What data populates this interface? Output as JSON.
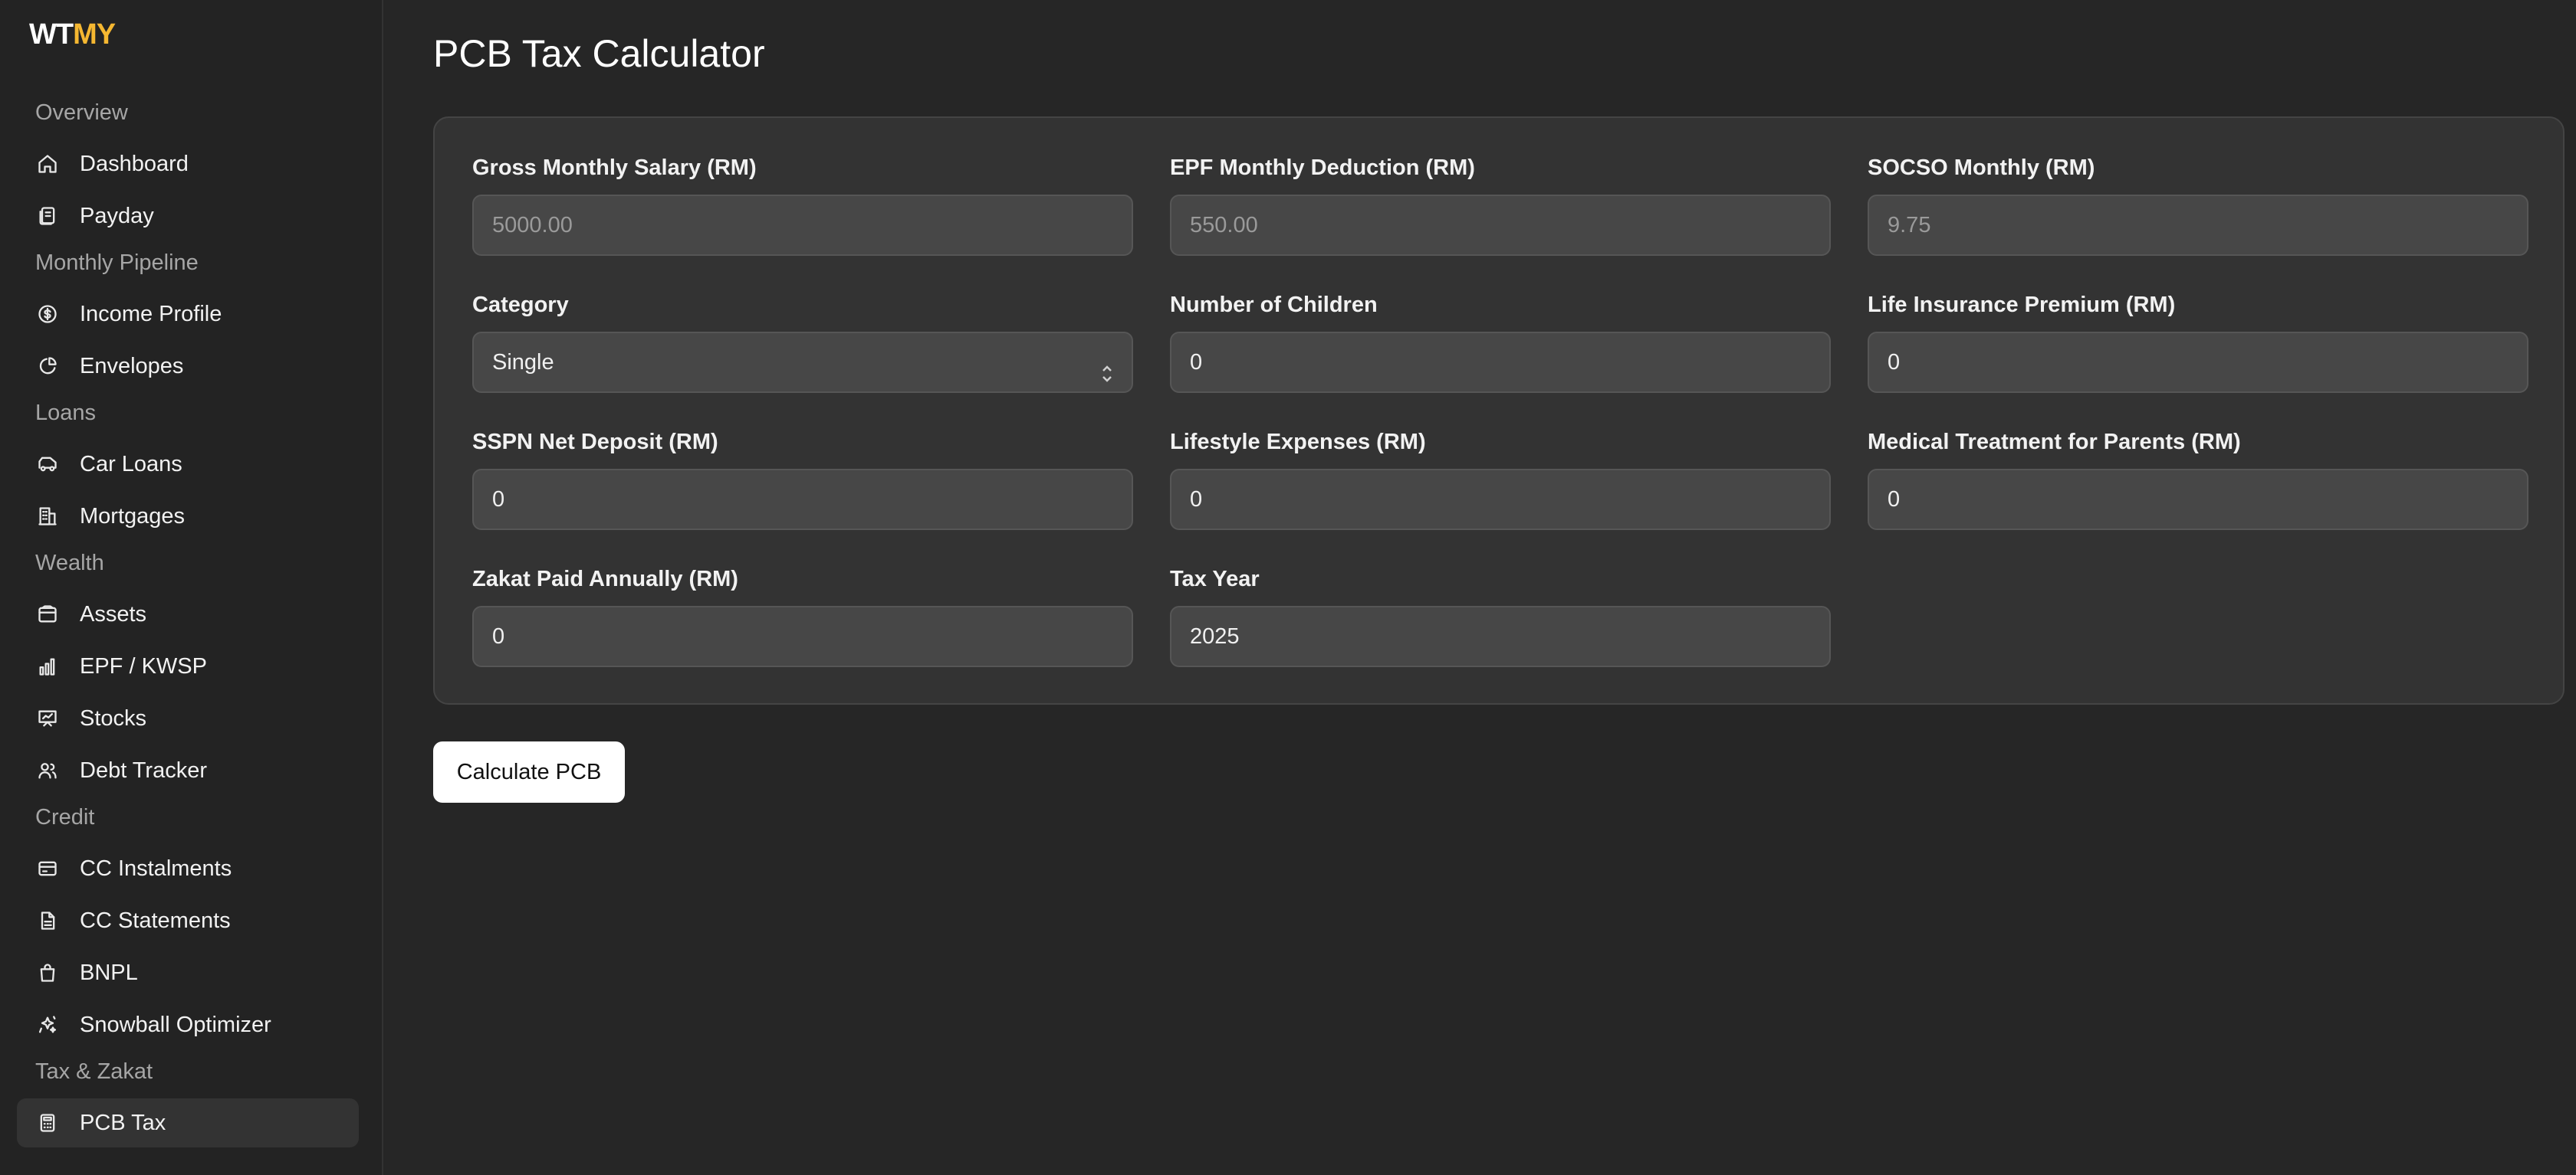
{
  "logo": {
    "part1": "WT",
    "part2": "MY"
  },
  "sidebar": {
    "groups": [
      {
        "label": "Overview"
      },
      {
        "label": "Monthly Pipeline"
      },
      {
        "label": "Loans"
      },
      {
        "label": "Wealth"
      },
      {
        "label": "Credit"
      },
      {
        "label": "Tax & Zakat"
      }
    ],
    "items": [
      {
        "label": "Dashboard",
        "icon": "home-icon"
      },
      {
        "label": "Payday",
        "icon": "receipt-icon"
      },
      {
        "label": "Income Profile",
        "icon": "dollar-circle-icon"
      },
      {
        "label": "Envelopes",
        "icon": "pie-chart-icon"
      },
      {
        "label": "Car Loans",
        "icon": "car-icon"
      },
      {
        "label": "Mortgages",
        "icon": "building-icon"
      },
      {
        "label": "Assets",
        "icon": "wallet-icon"
      },
      {
        "label": "EPF / KWSP",
        "icon": "bar-chart-icon"
      },
      {
        "label": "Stocks",
        "icon": "presentation-chart-icon"
      },
      {
        "label": "Debt Tracker",
        "icon": "users-icon"
      },
      {
        "label": "CC Instalments",
        "icon": "credit-card-icon"
      },
      {
        "label": "CC Statements",
        "icon": "file-text-icon"
      },
      {
        "label": "BNPL",
        "icon": "shopping-bag-icon"
      },
      {
        "label": "Snowball Optimizer",
        "icon": "sparkles-icon"
      },
      {
        "label": "PCB Tax",
        "icon": "calculator-icon",
        "active": true
      }
    ]
  },
  "main": {
    "title": "PCB Tax Calculator",
    "fields": [
      {
        "label": "Gross Monthly Salary (RM)",
        "value": "5000.00"
      },
      {
        "label": "EPF Monthly Deduction (RM)",
        "value": "550.00"
      },
      {
        "label": "SOCSO Monthly (RM)",
        "value": "9.75"
      },
      {
        "label": "Category",
        "value": "Single"
      },
      {
        "label": "Number of Children",
        "value": "0"
      },
      {
        "label": "Life Insurance Premium (RM)",
        "value": "0"
      },
      {
        "label": "SSPN Net Deposit (RM)",
        "value": "0"
      },
      {
        "label": "Lifestyle Expenses (RM)",
        "value": "0"
      },
      {
        "label": "Medical Treatment for Parents (RM)",
        "value": "0"
      },
      {
        "label": "Zakat Paid Annually (RM)",
        "value": "0"
      },
      {
        "label": "Tax Year",
        "value": "2025"
      }
    ],
    "calculate_label": "Calculate PCB"
  }
}
